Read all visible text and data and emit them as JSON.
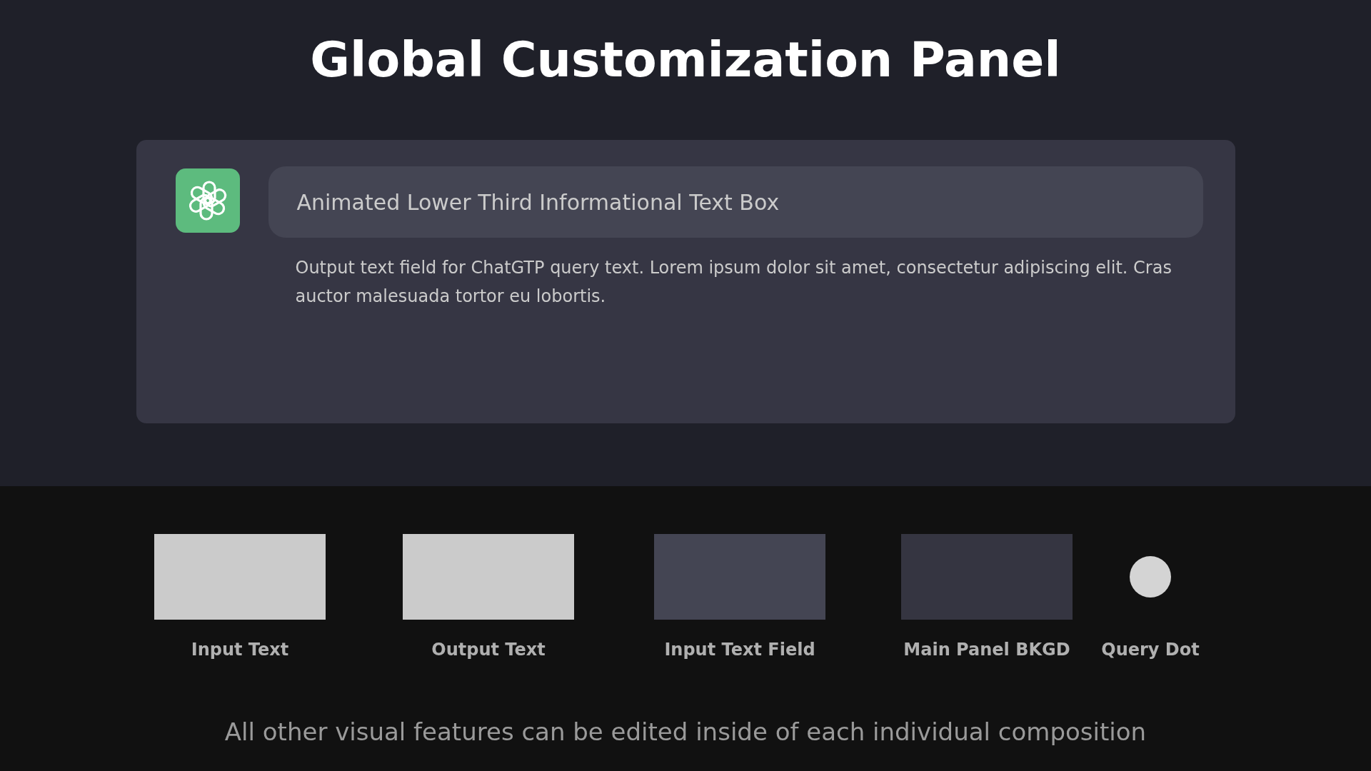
{
  "title": "Global Customization Panel",
  "panel": {
    "input_text": "Animated Lower Third Informational Text Box",
    "output_text": "Output text field for ChatGTP query text. Lorem ipsum dolor sit amet, consectetur adipiscing elit. Cras auctor malesuada tortor eu lobortis."
  },
  "swatches": [
    {
      "kind": "rect",
      "label": "Input Text",
      "color": "#cbcbcb"
    },
    {
      "kind": "rect",
      "label": "Output Text",
      "color": "#cbcbcb"
    },
    {
      "kind": "rect",
      "label": "Input Text Field",
      "color": "#444553"
    },
    {
      "kind": "rect",
      "label": "Main Panel BKGD",
      "color": "#353541"
    },
    {
      "kind": "dot",
      "label": "Query Dot",
      "color": "#d4d4d4"
    }
  ],
  "footer": "All other visual features can be edited inside of each individual composition"
}
